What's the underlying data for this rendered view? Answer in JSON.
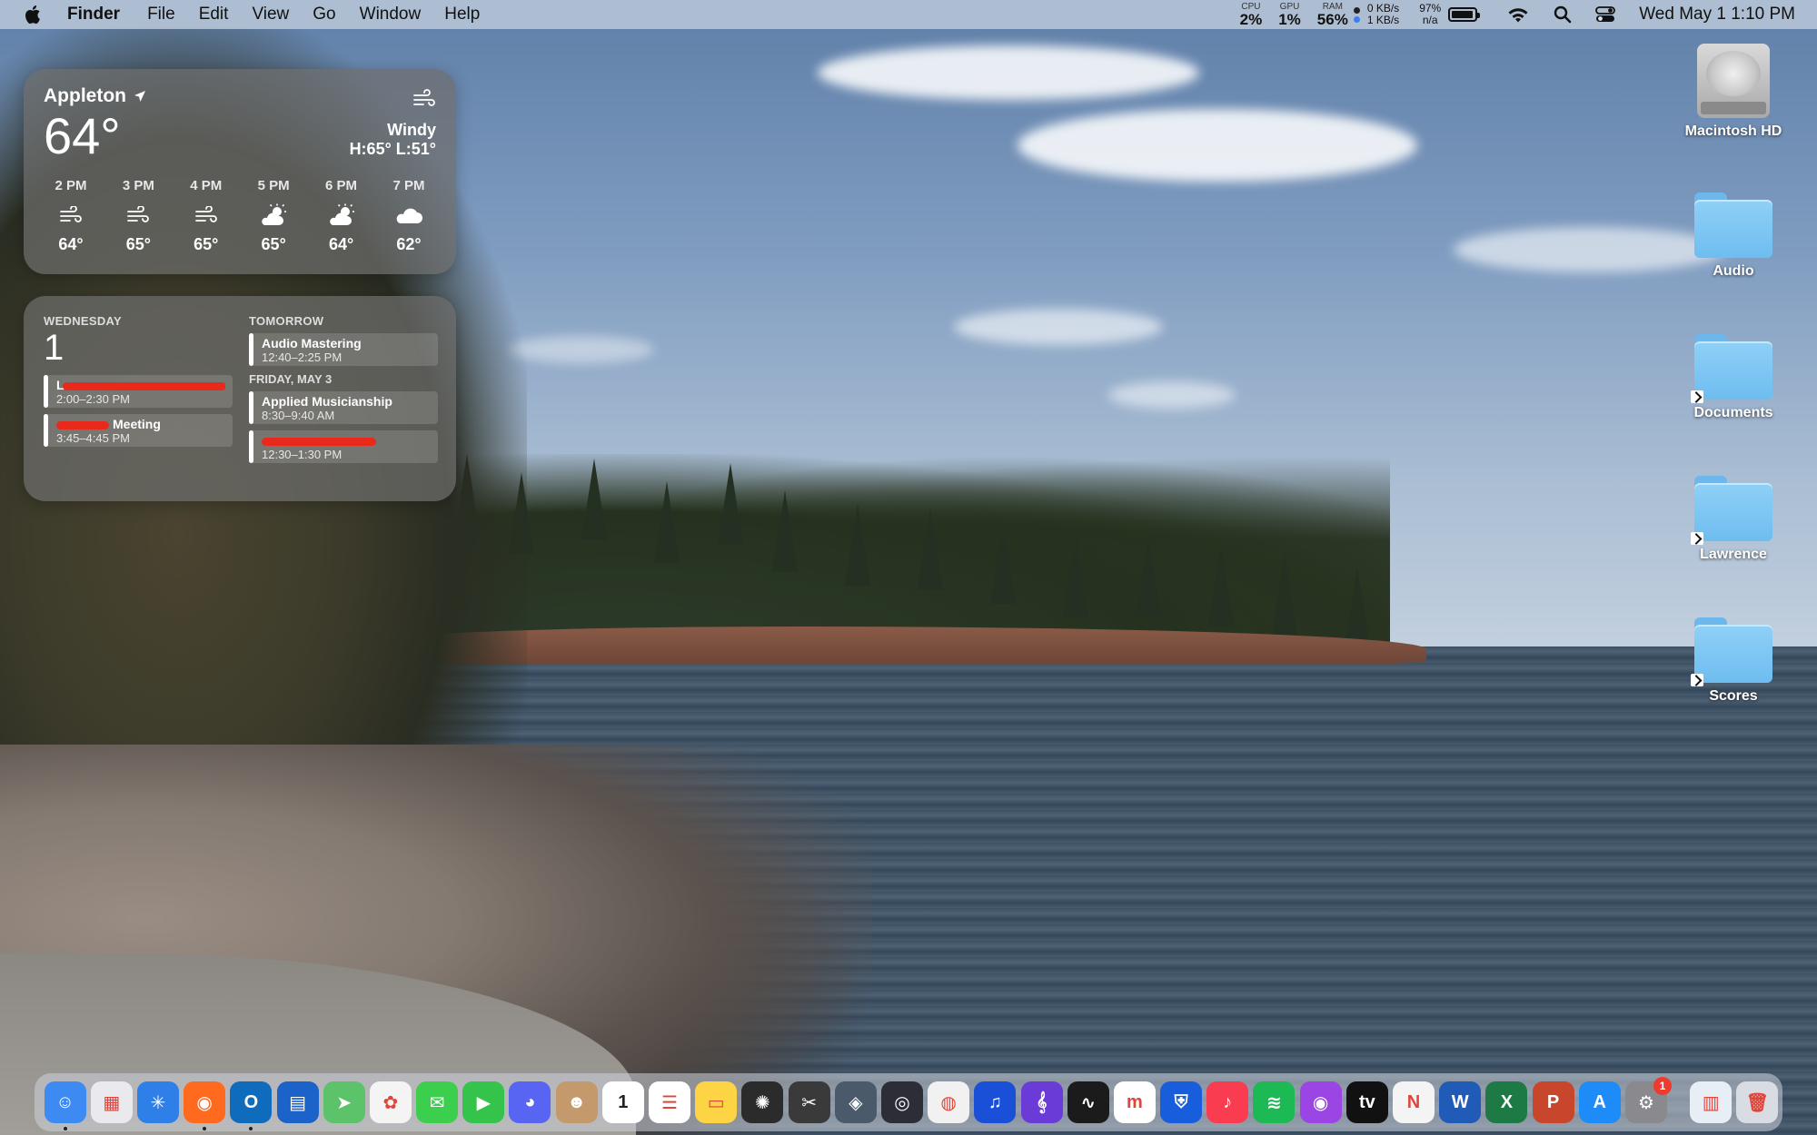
{
  "menubar": {
    "app_name": "Finder",
    "menus": [
      "File",
      "Edit",
      "View",
      "Go",
      "Window",
      "Help"
    ],
    "stats": {
      "cpu_label": "CPU",
      "cpu_value": "2%",
      "gpu_label": "GPU",
      "gpu_value": "1%",
      "ram_label": "RAM",
      "ram_value": "56%"
    },
    "network": {
      "up": "0 KB/s",
      "down": "1 KB/s"
    },
    "battery": {
      "percent": "97%",
      "time": "n/a",
      "level": 0.97
    },
    "clock": "Wed May 1  1:10 PM",
    "icons": [
      "apple-logo-icon",
      "battery-icon",
      "wifi-icon",
      "search-icon",
      "control-center-icon"
    ]
  },
  "weather": {
    "city": "Appleton",
    "temp": "64°",
    "condition": "Windy",
    "high_low": "H:65° L:51°",
    "hours": [
      {
        "time": "2 PM",
        "icon": "wind-icon",
        "temp": "64°"
      },
      {
        "time": "3 PM",
        "icon": "wind-icon",
        "temp": "65°"
      },
      {
        "time": "4 PM",
        "icon": "wind-icon",
        "temp": "65°"
      },
      {
        "time": "5 PM",
        "icon": "partly-sunny-icon",
        "temp": "65°"
      },
      {
        "time": "6 PM",
        "icon": "partly-sunny-icon",
        "temp": "64°"
      },
      {
        "time": "7 PM",
        "icon": "cloud-icon",
        "temp": "62°"
      }
    ]
  },
  "calendar": {
    "today_label": "WEDNESDAY",
    "today_date": "1",
    "today_events": [
      {
        "title": "L",
        "time": "2:00–2:30 PM"
      },
      {
        "title": "Meeting",
        "time": "3:45–4:45 PM"
      }
    ],
    "tomorrow_label": "TOMORROW",
    "tomorrow_events": [
      {
        "title": "Audio Mastering",
        "time": "12:40–2:25 PM"
      }
    ],
    "friday_label": "FRIDAY, MAY 3",
    "friday_events": [
      {
        "title": "Applied Musicianship",
        "time": "8:30–9:40 AM"
      },
      {
        "title": "",
        "time": "12:30–1:30 PM"
      }
    ]
  },
  "desktop": [
    {
      "label": "Macintosh HD",
      "type": "drive"
    },
    {
      "label": "Audio",
      "type": "folder"
    },
    {
      "label": "Documents",
      "type": "folder-alias"
    },
    {
      "label": "Lawrence",
      "type": "folder-alias"
    },
    {
      "label": "Scores",
      "type": "folder-alias"
    }
  ],
  "dock": {
    "apps": [
      {
        "name": "finder-icon",
        "color": "#3d8bf2",
        "glyph": "☺",
        "running": true
      },
      {
        "name": "launchpad-icon",
        "color": "#e9e9ee",
        "glyph": "▦",
        "running": false
      },
      {
        "name": "safari-icon",
        "color": "#2f7fe8",
        "glyph": "✳",
        "running": false
      },
      {
        "name": "firefox-icon",
        "color": "#ff6a1f",
        "glyph": "◉",
        "running": true
      },
      {
        "name": "outlook-icon",
        "color": "#0f6cbd",
        "glyph": "O",
        "running": true
      },
      {
        "name": "files-icon",
        "color": "#1c63c9",
        "glyph": "▤",
        "running": false
      },
      {
        "name": "maps-icon",
        "color": "#5cc36a",
        "glyph": "➤",
        "running": false
      },
      {
        "name": "photos-icon",
        "color": "#f4f4f4",
        "glyph": "✿",
        "running": false
      },
      {
        "name": "messages-icon",
        "color": "#3ccf4e",
        "glyph": "✉",
        "running": false
      },
      {
        "name": "facetime-icon",
        "color": "#35c44b",
        "glyph": "▶",
        "running": false
      },
      {
        "name": "discord-icon",
        "color": "#5865f2",
        "glyph": "◕",
        "running": false
      },
      {
        "name": "contacts-icon",
        "color": "#c49a6c",
        "glyph": "☻",
        "running": false
      },
      {
        "name": "calendar-icon",
        "color": "#ffffff",
        "glyph": "1",
        "running": false
      },
      {
        "name": "reminders-icon",
        "color": "#ffffff",
        "glyph": "☰",
        "running": false
      },
      {
        "name": "notes-icon",
        "color": "#fdd443",
        "glyph": "▭",
        "running": false
      },
      {
        "name": "davinci-resolve-icon",
        "color": "#2b2b2b",
        "glyph": "✺",
        "running": false
      },
      {
        "name": "final-cut-icon",
        "color": "#3a3a3a",
        "glyph": "✂",
        "running": false
      },
      {
        "name": "compressor-icon",
        "color": "#4a5a6a",
        "glyph": "◈",
        "running": false
      },
      {
        "name": "obs-icon",
        "color": "#2d2d38",
        "glyph": "◎",
        "running": false
      },
      {
        "name": "logic-icon",
        "color": "#f1f1f1",
        "glyph": "◍",
        "running": false
      },
      {
        "name": "audacity-icon",
        "color": "#1a4fd8",
        "glyph": "♫",
        "running": false
      },
      {
        "name": "musescore-icon",
        "color": "#6b3bd8",
        "glyph": "𝄞",
        "running": false
      },
      {
        "name": "activity-monitor-icon",
        "color": "#1b1b1b",
        "glyph": "∿",
        "running": false
      },
      {
        "name": "miro-icon",
        "color": "#ffffff",
        "glyph": "m",
        "running": false
      },
      {
        "name": "bitwarden-icon",
        "color": "#175ddc",
        "glyph": "⛨",
        "running": false
      },
      {
        "name": "music-icon",
        "color": "#fa3c50",
        "glyph": "♪",
        "running": false
      },
      {
        "name": "spotify-icon",
        "color": "#1db954",
        "glyph": "≋",
        "running": false
      },
      {
        "name": "podcasts-icon",
        "color": "#9b45e4",
        "glyph": "◉",
        "running": false
      },
      {
        "name": "tv-icon",
        "color": "#111111",
        "glyph": "tv",
        "running": false
      },
      {
        "name": "news-icon",
        "color": "#f4f4f4",
        "glyph": "N",
        "running": false
      },
      {
        "name": "word-icon",
        "color": "#1f5bb7",
        "glyph": "W",
        "running": false
      },
      {
        "name": "excel-icon",
        "color": "#1d7a44",
        "glyph": "X",
        "running": false
      },
      {
        "name": "powerpoint-icon",
        "color": "#c8462b",
        "glyph": "P",
        "running": false
      },
      {
        "name": "app-store-icon",
        "color": "#1d8cf8",
        "glyph": "A",
        "running": false
      },
      {
        "name": "system-settings-icon",
        "color": "#8a8a8e",
        "glyph": "⚙",
        "running": false,
        "badge": "1"
      }
    ],
    "trailing": [
      {
        "name": "downloads-stack-icon",
        "color": "#e8eef6",
        "glyph": "▥"
      },
      {
        "name": "trash-icon",
        "color": "#d9dde3",
        "glyph": "🗑"
      }
    ]
  }
}
